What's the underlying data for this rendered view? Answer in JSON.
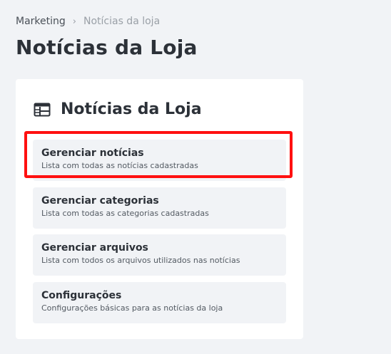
{
  "breadcrumb": {
    "parent": "Marketing",
    "separator": ">",
    "current": "Notícias da loja"
  },
  "page": {
    "title": "Notícias da Loja"
  },
  "card": {
    "icon": "table-layout-icon",
    "title": "Notícias da Loja",
    "items": [
      {
        "title": "Gerenciar notícias",
        "description": "Lista com todas as notícias cadastradas",
        "highlighted": true
      },
      {
        "title": "Gerenciar categorias",
        "description": "Lista com todas as categorias cadastradas",
        "highlighted": false
      },
      {
        "title": "Gerenciar arquivos",
        "description": "Lista com todos os arquivos utilizados nas notícias",
        "highlighted": false
      },
      {
        "title": "Configurações",
        "description": "Configurações básicas para as notícias da loja",
        "highlighted": false
      }
    ]
  },
  "colors": {
    "background": "#f1f3f6",
    "card": "#ffffff",
    "highlight": "#ff1010",
    "text": "#2c3138"
  }
}
